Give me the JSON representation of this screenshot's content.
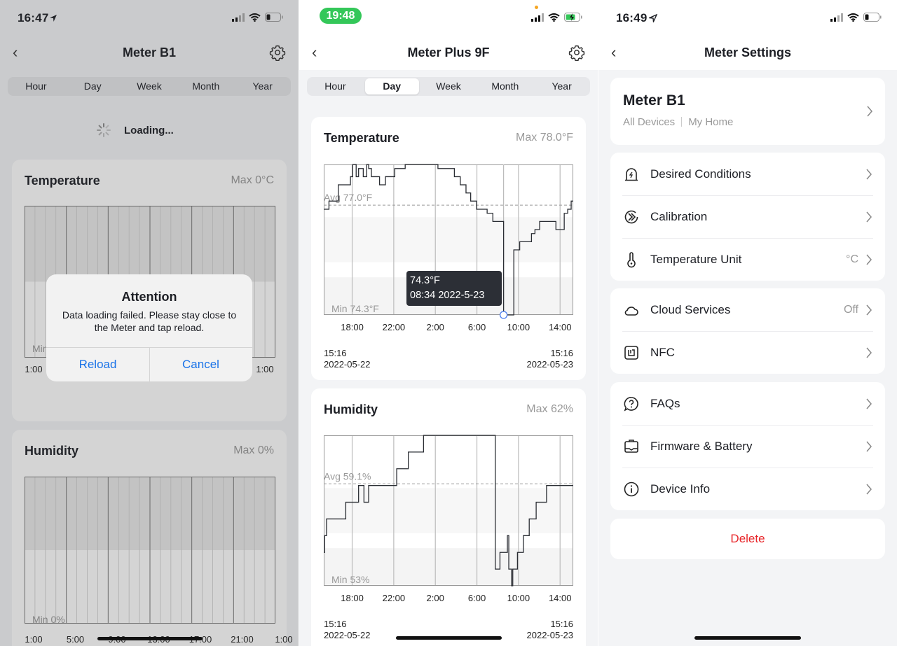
{
  "panel1": {
    "status": {
      "time": "16:47"
    },
    "nav": {
      "title": "Meter B1"
    },
    "tabs": [
      "Hour",
      "Day",
      "Week",
      "Month",
      "Year"
    ],
    "loading": "Loading...",
    "temperature": {
      "title": "Temperature",
      "max": "Max 0°C",
      "min": "Min 0°C",
      "x_labels": [
        "1:00",
        "1:00"
      ]
    },
    "humidity": {
      "title": "Humidity",
      "max": "Max 0%",
      "min": "Min 0%",
      "x_labels": [
        "1:00",
        "5:00",
        "9:00",
        "13:00",
        "17:00",
        "21:00",
        "1:00"
      ]
    },
    "dialog": {
      "title": "Attention",
      "message": "Data loading failed. Please stay close to the Meter and tap reload.",
      "reload": "Reload",
      "cancel": "Cancel"
    }
  },
  "panel2": {
    "status": {
      "time": "19:48"
    },
    "nav": {
      "title": "Meter Plus 9F"
    },
    "tabs": [
      "Hour",
      "Day",
      "Week",
      "Month",
      "Year"
    ],
    "selected_tab": "Day",
    "range": {
      "start_time": "15:16",
      "start_date": "2022-05-22",
      "end_time": "15:16",
      "end_date": "2022-05-23"
    },
    "tooltip": {
      "value": "74.3°F",
      "time": "08:34 2022-5-23"
    }
  },
  "chart_data": [
    {
      "type": "line",
      "title": "Temperature",
      "max_label": "Max 78.0°F",
      "avg_label": "Avg 77.0°F",
      "min_label": "Min 74.3°F",
      "avg": 77.0,
      "ylim": [
        74.3,
        78.0
      ],
      "xlim": [
        "2022-05-22 15:16",
        "2022-05-23 15:16"
      ],
      "x_ticks": [
        "18:00",
        "22:00",
        "2:00",
        "6:00",
        "10:00",
        "14:00"
      ],
      "points": [
        [
          "2022-05-22 15:16",
          76.9
        ],
        [
          "2022-05-22 15:46",
          77.1
        ],
        [
          "2022-05-22 16:40",
          77.5
        ],
        [
          "2022-05-22 17:50",
          77.7
        ],
        [
          "2022-05-22 18:03",
          78.0
        ],
        [
          "2022-05-22 18:23",
          77.7
        ],
        [
          "2022-05-22 18:37",
          77.9
        ],
        [
          "2022-05-22 19:04",
          77.7
        ],
        [
          "2022-05-22 19:24",
          78.0
        ],
        [
          "2022-05-22 19:35",
          77.9
        ],
        [
          "2022-05-22 19:51",
          77.7
        ],
        [
          "2022-05-22 20:38",
          77.5
        ],
        [
          "2022-05-22 21:12",
          77.7
        ],
        [
          "2022-05-22 22:06",
          77.9
        ],
        [
          "2022-05-22 23:06",
          78.0
        ],
        [
          "2022-05-23 02:15",
          77.9
        ],
        [
          "2022-05-23 03:50",
          77.7
        ],
        [
          "2022-05-23 04:24",
          77.5
        ],
        [
          "2022-05-23 04:57",
          77.3
        ],
        [
          "2022-05-23 05:24",
          77.1
        ],
        [
          "2022-05-23 05:58",
          76.9
        ],
        [
          "2022-05-23 06:59",
          76.8
        ],
        [
          "2022-05-23 07:32",
          76.6
        ],
        [
          "2022-05-23 07:46",
          76.6
        ],
        [
          "2022-05-23 08:34",
          74.3
        ],
        [
          "2022-05-23 08:53",
          74.3
        ],
        [
          "2022-05-23 09:33",
          75.9
        ],
        [
          "2022-05-23 10:07",
          76.1
        ],
        [
          "2022-05-23 11:15",
          76.3
        ],
        [
          "2022-05-23 11:35",
          76.4
        ],
        [
          "2022-05-23 12:02",
          76.6
        ],
        [
          "2022-05-23 13:36",
          76.4
        ],
        [
          "2022-05-23 14:24",
          76.8
        ],
        [
          "2022-05-23 14:44",
          76.9
        ],
        [
          "2022-05-23 15:04",
          77.1
        ],
        [
          "2022-05-23 15:16",
          77.1
        ]
      ],
      "highlight": [
        "2022-05-23 08:34",
        74.3
      ]
    },
    {
      "type": "line",
      "title": "Humidity",
      "max_label": "Max 62%",
      "avg_label": "Avg 59.1%",
      "min_label": "Min 53%",
      "avg": 59.1,
      "ylim": [
        53,
        62
      ],
      "xlim": [
        "2022-05-22 15:16",
        "2022-05-23 15:16"
      ],
      "x_ticks": [
        "18:00",
        "22:00",
        "2:00",
        "6:00",
        "10:00",
        "14:00"
      ],
      "points": [
        [
          "2022-05-22 15:16",
          55
        ],
        [
          "2022-05-22 15:21",
          56
        ],
        [
          "2022-05-22 15:32",
          57
        ],
        [
          "2022-05-22 17:23",
          58
        ],
        [
          "2022-05-22 18:37",
          59
        ],
        [
          "2022-05-22 19:08",
          58
        ],
        [
          "2022-05-22 19:35",
          59
        ],
        [
          "2022-05-22 22:17",
          60
        ],
        [
          "2022-05-22 23:24",
          61
        ],
        [
          "2022-05-23 00:52",
          62
        ],
        [
          "2022-05-23 07:46",
          54
        ],
        [
          "2022-05-23 08:13",
          55
        ],
        [
          "2022-05-23 08:56",
          56
        ],
        [
          "2022-05-23 09:04",
          54
        ],
        [
          "2022-05-23 09:20",
          53
        ],
        [
          "2022-05-23 09:27",
          54
        ],
        [
          "2022-05-23 09:54",
          55
        ],
        [
          "2022-05-23 10:28",
          56
        ],
        [
          "2022-05-23 11:02",
          57
        ],
        [
          "2022-05-23 11:42",
          58
        ],
        [
          "2022-05-23 12:42",
          59
        ],
        [
          "2022-05-23 15:16",
          59
        ]
      ]
    }
  ],
  "panel3": {
    "status": {
      "time": "16:49"
    },
    "nav": {
      "title": "Meter Settings"
    },
    "device": {
      "name": "Meter B1",
      "group": "All Devices",
      "room": "My Home"
    },
    "groups": [
      [
        {
          "label": "Desired Conditions",
          "icon": "desired-conditions-icon"
        },
        {
          "label": "Calibration",
          "icon": "calibration-icon"
        },
        {
          "label": "Temperature Unit",
          "value": "°C",
          "icon": "thermometer-icon"
        }
      ],
      [
        {
          "label": "Cloud Services",
          "value": "Off",
          "icon": "cloud-icon"
        },
        {
          "label": "NFC",
          "icon": "nfc-icon"
        }
      ],
      [
        {
          "label": "FAQs",
          "icon": "faq-icon"
        },
        {
          "label": "Firmware & Battery",
          "icon": "firmware-battery-icon"
        },
        {
          "label": "Device Info",
          "icon": "info-icon"
        }
      ]
    ],
    "delete": "Delete"
  },
  "colors": {
    "accent_blue": "#1a73e8",
    "delete_red": "#e8262a",
    "status_green": "#34c759",
    "tooltip_bg": "#2c2f36"
  }
}
